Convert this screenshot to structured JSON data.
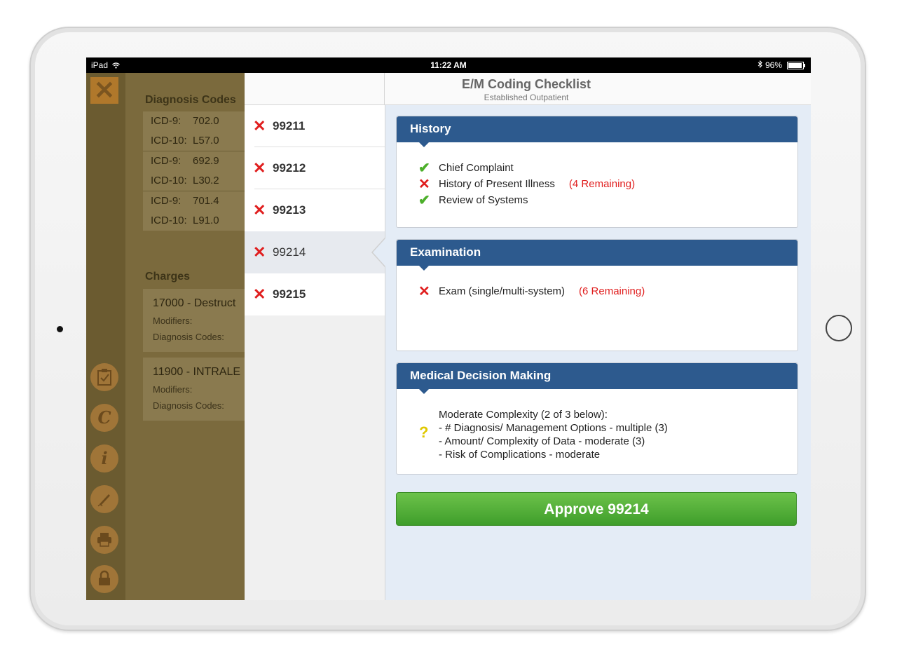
{
  "statusbar": {
    "device": "iPad",
    "time": "11:22 AM",
    "battery": "96%",
    "wifi_icon": "wifi-icon",
    "bluetooth_icon": "bluetooth-icon"
  },
  "background": {
    "diagnosis_title": "Diagnosis Codes",
    "diagnosis_codes": [
      {
        "icd9_label": "ICD-9:",
        "icd9": "702.0",
        "icd10_label": "ICD-10:",
        "icd10": "L57.0"
      },
      {
        "icd9_label": "ICD-9:",
        "icd9": "692.9",
        "icd10_label": "ICD-10:",
        "icd10": "L30.2"
      },
      {
        "icd9_label": "ICD-9:",
        "icd9": "701.4",
        "icd10_label": "ICD-10:",
        "icd10": "L91.0"
      }
    ],
    "charges_title": "Charges",
    "charges": [
      {
        "title": "17000 - Destruct",
        "modifiers": "Modifiers:",
        "diagnosis": "Diagnosis Codes:"
      },
      {
        "title": "11900 - INTRALE",
        "modifiers": "Modifiers:",
        "diagnosis": "Diagnosis Codes:"
      }
    ],
    "close_label": "✕"
  },
  "header": {
    "title": "E/M Coding Checklist",
    "subtitle": "Established Outpatient"
  },
  "codes": [
    {
      "code": "99211",
      "status": "✕"
    },
    {
      "code": "99212",
      "status": "✕"
    },
    {
      "code": "99213",
      "status": "✕"
    },
    {
      "code": "99214",
      "status": "✕"
    },
    {
      "code": "99215",
      "status": "✕"
    }
  ],
  "selected_code": "99214",
  "history": {
    "title": "History",
    "items": [
      {
        "mark": "✔",
        "label": "Chief Complaint",
        "remaining": ""
      },
      {
        "mark": "✕",
        "label": "History of Present Illness",
        "remaining": "(4 Remaining)"
      },
      {
        "mark": "✔",
        "label": "Review of Systems",
        "remaining": ""
      }
    ]
  },
  "examination": {
    "title": "Examination",
    "items": [
      {
        "mark": "✕",
        "label": "Exam (single/multi-system)",
        "remaining": "(6 Remaining)"
      }
    ]
  },
  "mdm": {
    "title": "Medical Decision Making",
    "mark": "?",
    "lines": [
      "Moderate Complexity (2 of 3 below):",
      "- # Diagnosis/ Management Options - multiple (3)",
      "- Amount/ Complexity of Data - moderate (3)",
      "- Risk of Complications - moderate"
    ]
  },
  "approve_label": "Approve 99214",
  "colors": {
    "header_blue": "#2d5a8e",
    "approve_green": "#4caf2a",
    "error_red": "#e01e1e",
    "detail_bg": "#e4ecf6"
  }
}
